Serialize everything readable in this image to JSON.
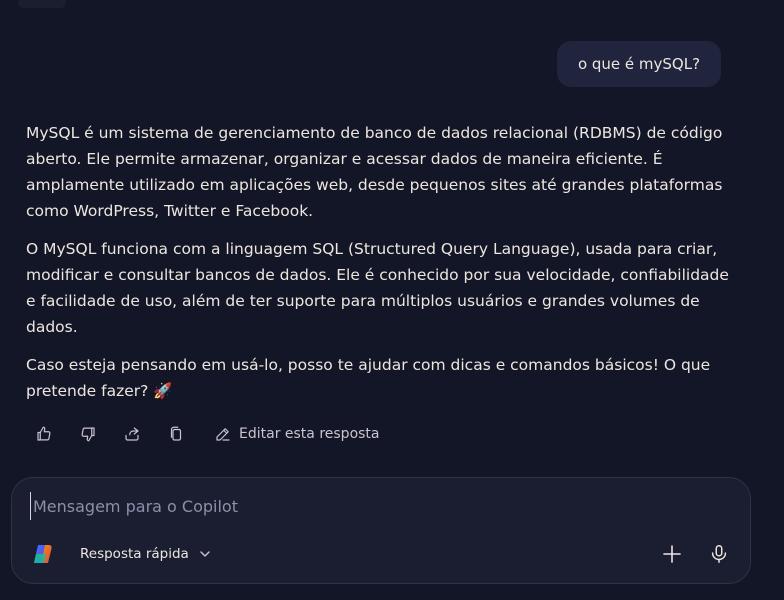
{
  "user_message": {
    "text": "o que é mySQL?"
  },
  "assistant_message": {
    "paragraphs": [
      "MySQL é um sistema de gerenciamento de banco de dados relacional (RDBMS) de código aberto. Ele permite armazenar, organizar e acessar dados de maneira eficiente. É amplamente utilizado em aplicações web, desde pequenos sites até grandes plataformas como WordPress, Twitter e Facebook.",
      "O MySQL funciona com a linguagem SQL (Structured Query Language), usada para criar, modificar e consultar bancos de dados. Ele é conhecido por sua velocidade, confiabilidade e facilidade de uso, além de ter suporte para múltiplos usuários e grandes volumes de dados.",
      "Caso esteja pensando em usá-lo, posso te ajudar com dicas e comandos básicos! O que pretende fazer? 🚀"
    ]
  },
  "actions": {
    "icons": [
      "thumbs-up-icon",
      "thumbs-down-icon",
      "share-icon",
      "copy-icon"
    ],
    "edit_label": "Editar esta resposta"
  },
  "composer": {
    "placeholder": "Mensagem para o Copilot",
    "value": "",
    "mode_label": "Resposta rápida"
  },
  "colors": {
    "background": "#131627",
    "user_bubble": "#20253d",
    "composer_bg": "#1a1e30",
    "text": "#ece6df",
    "placeholder": "#8d8fa8"
  }
}
